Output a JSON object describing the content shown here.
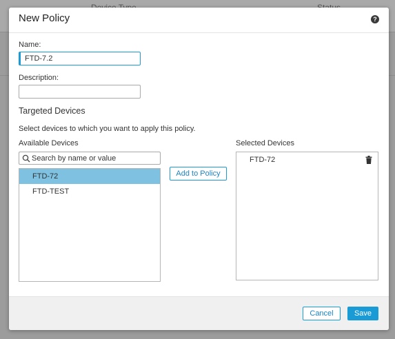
{
  "background": {
    "columns": [
      "Device Type",
      "Status"
    ]
  },
  "dialog": {
    "title": "New Policy",
    "help_icon": "question-circle-icon",
    "name_label": "Name:",
    "name_value": "FTD-7.2",
    "description_label": "Description:",
    "description_value": "",
    "targeted_title": "Targeted Devices",
    "instruction": "Select devices to which you want to apply this policy.",
    "available_label": "Available Devices",
    "search_placeholder": "Search by name or value",
    "available_devices": [
      {
        "name": "FTD-72",
        "selected": true
      },
      {
        "name": "FTD-TEST",
        "selected": false
      }
    ],
    "add_button": "Add to Policy",
    "selected_label": "Selected Devices",
    "selected_devices": [
      "FTD-72"
    ],
    "cancel_button": "Cancel",
    "save_button": "Save"
  },
  "colors": {
    "accent": "#1b9bd6",
    "selection": "#7ec1e0",
    "overlay": "#9c9c9c"
  }
}
